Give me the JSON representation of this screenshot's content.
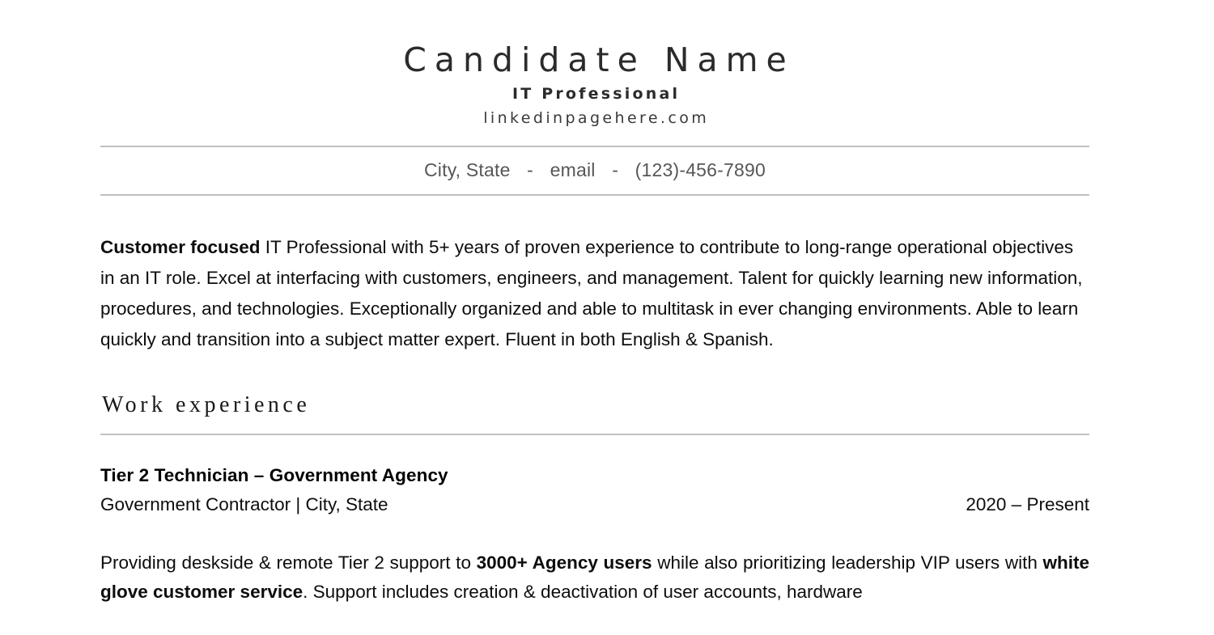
{
  "document": {
    "type": "resume",
    "background_color": "#ffffff",
    "rule_color": "#bfbfbf",
    "text_color": "#0d0d0d",
    "muted_text_color": "#575757"
  },
  "header": {
    "name": "Candidate Name",
    "role": "IT Professional",
    "link": "linkedinpagehere.com",
    "contact": {
      "location": "City, State",
      "separator": "-",
      "email": "email",
      "phone": "(123)-456-7890"
    }
  },
  "summary": {
    "lead_bold": "Customer focused",
    "rest": " IT Professional with 5+ years of proven experience to contribute to long-range operational objectives in an IT role. Excel at interfacing with customers, engineers, and management. Talent for quickly learning new information, procedures, and technologies. Exceptionally organized and able to multitask in ever changing environments. Able to learn quickly and transition into a subject matter expert. Fluent in both English & Spanish."
  },
  "work_experience": {
    "section_title": "Work experience",
    "jobs": [
      {
        "title": "Tier 2 Technician – Government Agency",
        "employer": "Government Contractor | City, State",
        "dates": "2020 – Present",
        "description_part1": "Providing deskside & remote Tier 2 support to ",
        "description_bold1": "3000+ Agency users",
        "description_part2": " while also prioritizing leadership VIP users with ",
        "description_bold2": "white glove customer service",
        "description_part3": ". Support includes creation & deactivation of user accounts, hardware"
      }
    ]
  }
}
